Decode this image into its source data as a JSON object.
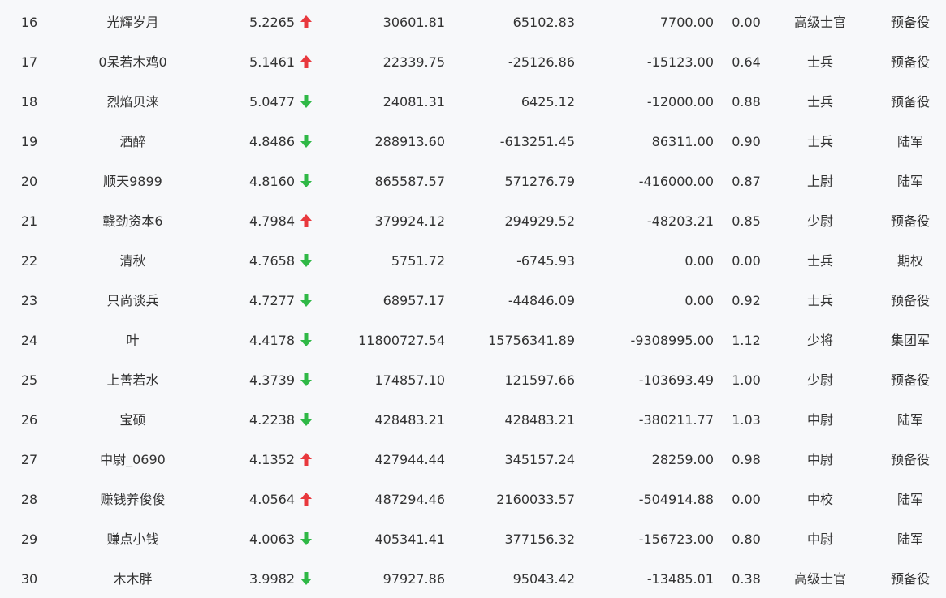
{
  "colors": {
    "up": "#e8383d",
    "down": "#2fb846",
    "text": "#333333",
    "background": "#f7f8fa"
  },
  "rows": [
    {
      "rank": "16",
      "name": "光辉岁月",
      "score": "5.2265",
      "trend": "up",
      "v1": "30601.81",
      "v2": "65102.83",
      "v3": "7700.00",
      "ratio": "0.00",
      "title": "高级士官",
      "group": "预备役"
    },
    {
      "rank": "17",
      "name": "0呆若木鸡0",
      "score": "5.1461",
      "trend": "up",
      "v1": "22339.75",
      "v2": "-25126.86",
      "v3": "-15123.00",
      "ratio": "0.64",
      "title": "士兵",
      "group": "预备役"
    },
    {
      "rank": "18",
      "name": "烈焰贝涞",
      "score": "5.0477",
      "trend": "down",
      "v1": "24081.31",
      "v2": "6425.12",
      "v3": "-12000.00",
      "ratio": "0.88",
      "title": "士兵",
      "group": "预备役"
    },
    {
      "rank": "19",
      "name": "酒醉",
      "score": "4.8486",
      "trend": "down",
      "v1": "288913.60",
      "v2": "-613251.45",
      "v3": "86311.00",
      "ratio": "0.90",
      "title": "士兵",
      "group": "陆军"
    },
    {
      "rank": "20",
      "name": "顺天9899",
      "score": "4.8160",
      "trend": "down",
      "v1": "865587.57",
      "v2": "571276.79",
      "v3": "-416000.00",
      "ratio": "0.87",
      "title": "上尉",
      "group": "陆军"
    },
    {
      "rank": "21",
      "name": "赣劲资本6",
      "score": "4.7984",
      "trend": "up",
      "v1": "379924.12",
      "v2": "294929.52",
      "v3": "-48203.21",
      "ratio": "0.85",
      "title": "少尉",
      "group": "预备役"
    },
    {
      "rank": "22",
      "name": "清秋",
      "score": "4.7658",
      "trend": "down",
      "v1": "5751.72",
      "v2": "-6745.93",
      "v3": "0.00",
      "ratio": "0.00",
      "title": "士兵",
      "group": "期权"
    },
    {
      "rank": "23",
      "name": "只尚谈兵",
      "score": "4.7277",
      "trend": "down",
      "v1": "68957.17",
      "v2": "-44846.09",
      "v3": "0.00",
      "ratio": "0.92",
      "title": "士兵",
      "group": "预备役"
    },
    {
      "rank": "24",
      "name": "叶",
      "score": "4.4178",
      "trend": "down",
      "v1": "11800727.54",
      "v2": "15756341.89",
      "v3": "-9308995.00",
      "ratio": "1.12",
      "title": "少将",
      "group": "集团军"
    },
    {
      "rank": "25",
      "name": "上善若水",
      "score": "4.3739",
      "trend": "down",
      "v1": "174857.10",
      "v2": "121597.66",
      "v3": "-103693.49",
      "ratio": "1.00",
      "title": "少尉",
      "group": "预备役"
    },
    {
      "rank": "26",
      "name": "宝硕",
      "score": "4.2238",
      "trend": "down",
      "v1": "428483.21",
      "v2": "428483.21",
      "v3": "-380211.77",
      "ratio": "1.03",
      "title": "中尉",
      "group": "陆军"
    },
    {
      "rank": "27",
      "name": "中尉_0690",
      "score": "4.1352",
      "trend": "up",
      "v1": "427944.44",
      "v2": "345157.24",
      "v3": "28259.00",
      "ratio": "0.98",
      "title": "中尉",
      "group": "预备役"
    },
    {
      "rank": "28",
      "name": "赚钱养俊俊",
      "score": "4.0564",
      "trend": "up",
      "v1": "487294.46",
      "v2": "2160033.57",
      "v3": "-504914.88",
      "ratio": "0.00",
      "title": "中校",
      "group": "陆军"
    },
    {
      "rank": "29",
      "name": "赚点小钱",
      "score": "4.0063",
      "trend": "down",
      "v1": "405341.41",
      "v2": "377156.32",
      "v3": "-156723.00",
      "ratio": "0.80",
      "title": "中尉",
      "group": "陆军"
    },
    {
      "rank": "30",
      "name": "木木胖",
      "score": "3.9982",
      "trend": "down",
      "v1": "97927.86",
      "v2": "95043.42",
      "v3": "-13485.01",
      "ratio": "0.38",
      "title": "高级士官",
      "group": "预备役"
    }
  ]
}
